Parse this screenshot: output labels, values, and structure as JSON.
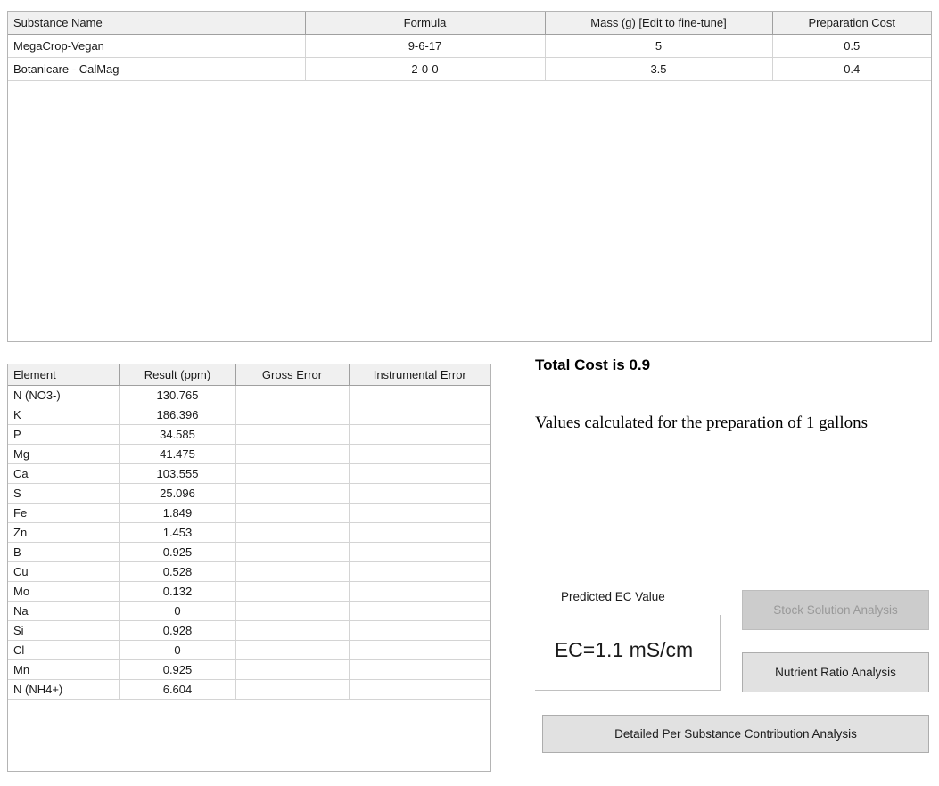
{
  "substance_table": {
    "name": "substance-table",
    "headers": [
      "Substance Name",
      "Formula",
      "Mass (g) [Edit to fine-tune]",
      "Preparation Cost"
    ],
    "rows": [
      {
        "substance": "MegaCrop-Vegan",
        "formula": "9-6-17",
        "mass": "5",
        "cost": "0.5"
      },
      {
        "substance": "Botanicare - CalMag",
        "formula": "2-0-0",
        "mass": "3.5",
        "cost": "0.4"
      }
    ]
  },
  "element_table": {
    "name": "element-results-table",
    "headers": [
      "Element",
      "Result (ppm)",
      "Gross Error",
      "Instrumental Error"
    ],
    "rows": [
      {
        "element": "N (NO3-)",
        "result": "130.765",
        "gross_error": "",
        "instrumental_error": ""
      },
      {
        "element": "K",
        "result": "186.396",
        "gross_error": "",
        "instrumental_error": ""
      },
      {
        "element": "P",
        "result": "34.585",
        "gross_error": "",
        "instrumental_error": ""
      },
      {
        "element": "Mg",
        "result": "41.475",
        "gross_error": "",
        "instrumental_error": ""
      },
      {
        "element": "Ca",
        "result": "103.555",
        "gross_error": "",
        "instrumental_error": ""
      },
      {
        "element": "S",
        "result": "25.096",
        "gross_error": "",
        "instrumental_error": ""
      },
      {
        "element": "Fe",
        "result": "1.849",
        "gross_error": "",
        "instrumental_error": ""
      },
      {
        "element": "Zn",
        "result": "1.453",
        "gross_error": "",
        "instrumental_error": ""
      },
      {
        "element": "B",
        "result": "0.925",
        "gross_error": "",
        "instrumental_error": ""
      },
      {
        "element": "Cu",
        "result": "0.528",
        "gross_error": "",
        "instrumental_error": ""
      },
      {
        "element": "Mo",
        "result": "0.132",
        "gross_error": "",
        "instrumental_error": ""
      },
      {
        "element": "Na",
        "result": "0",
        "gross_error": "",
        "instrumental_error": ""
      },
      {
        "element": "Si",
        "result": "0.928",
        "gross_error": "",
        "instrumental_error": ""
      },
      {
        "element": "Cl",
        "result": "0",
        "gross_error": "",
        "instrumental_error": ""
      },
      {
        "element": "Mn",
        "result": "0.925",
        "gross_error": "",
        "instrumental_error": ""
      },
      {
        "element": "N (NH4+)",
        "result": "6.604",
        "gross_error": "",
        "instrumental_error": ""
      }
    ]
  },
  "info": {
    "total_cost_text": "Total Cost is 0.9",
    "volume_note": "Values calculated for the preparation of 1 gallons",
    "ec_label": "Predicted EC Value",
    "ec_value": "EC=1.1 mS/cm"
  },
  "buttons": {
    "stock_solution": "Stock Solution Analysis",
    "nutrient_ratio": "Nutrient Ratio Analysis",
    "detailed_contribution": "Detailed Per Substance Contribution Analysis"
  },
  "colors": {
    "header_bg": "#f0f0f0",
    "button_bg": "#e1e1e1",
    "button_disabled_bg": "#cccccc",
    "button_disabled_text": "#9a9a9a",
    "grid_line": "#d4d4d4",
    "panel_border": "#b4b4b4"
  }
}
